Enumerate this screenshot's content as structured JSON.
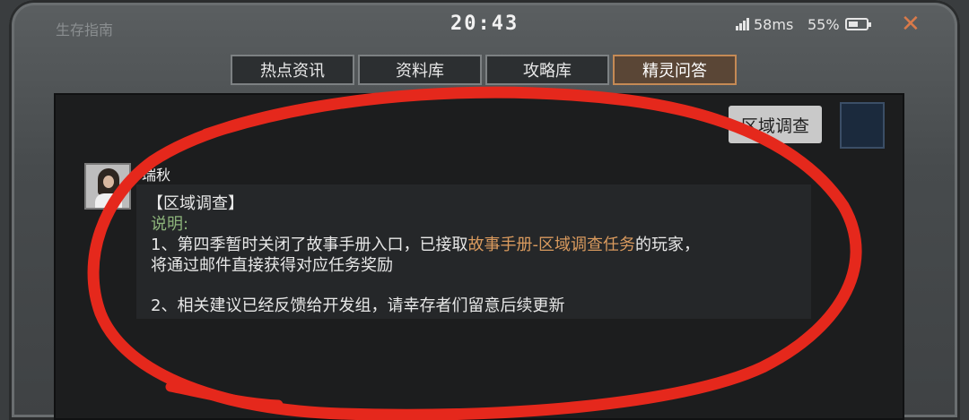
{
  "status_bar": {
    "app_name": "生存指南",
    "time": "20:43",
    "ping": "58ms",
    "battery_pct": "55%",
    "battery_level": 0.55,
    "close_label": "✕"
  },
  "tabs": [
    {
      "label": "热点资讯",
      "active": false
    },
    {
      "label": "资料库",
      "active": false
    },
    {
      "label": "攻略库",
      "active": false
    },
    {
      "label": "精灵问答",
      "active": true
    }
  ],
  "region_tag": {
    "label": "区域调查"
  },
  "message": {
    "sender": "瑞秋",
    "title": "【区域调查】",
    "label": "说明:",
    "line1_prefix": "1、第四季暂时关闭了故事手册入口，已接取",
    "line1_highlight": "故事手册-区域调查任务",
    "line1_suffix": "的玩家，",
    "line2": "将通过邮件直接获得对应任务奖励",
    "line3": "2、相关建议已经反馈给开发组，请幸存者们留意后续更新"
  },
  "colors": {
    "accent": "#c58a55",
    "highlight": "#d99a5e",
    "label_green": "#8cb37a",
    "annotation_red": "#e5281c"
  },
  "icons": [
    "signal-icon",
    "battery-icon",
    "close-icon",
    "avatar",
    "region-icon"
  ]
}
